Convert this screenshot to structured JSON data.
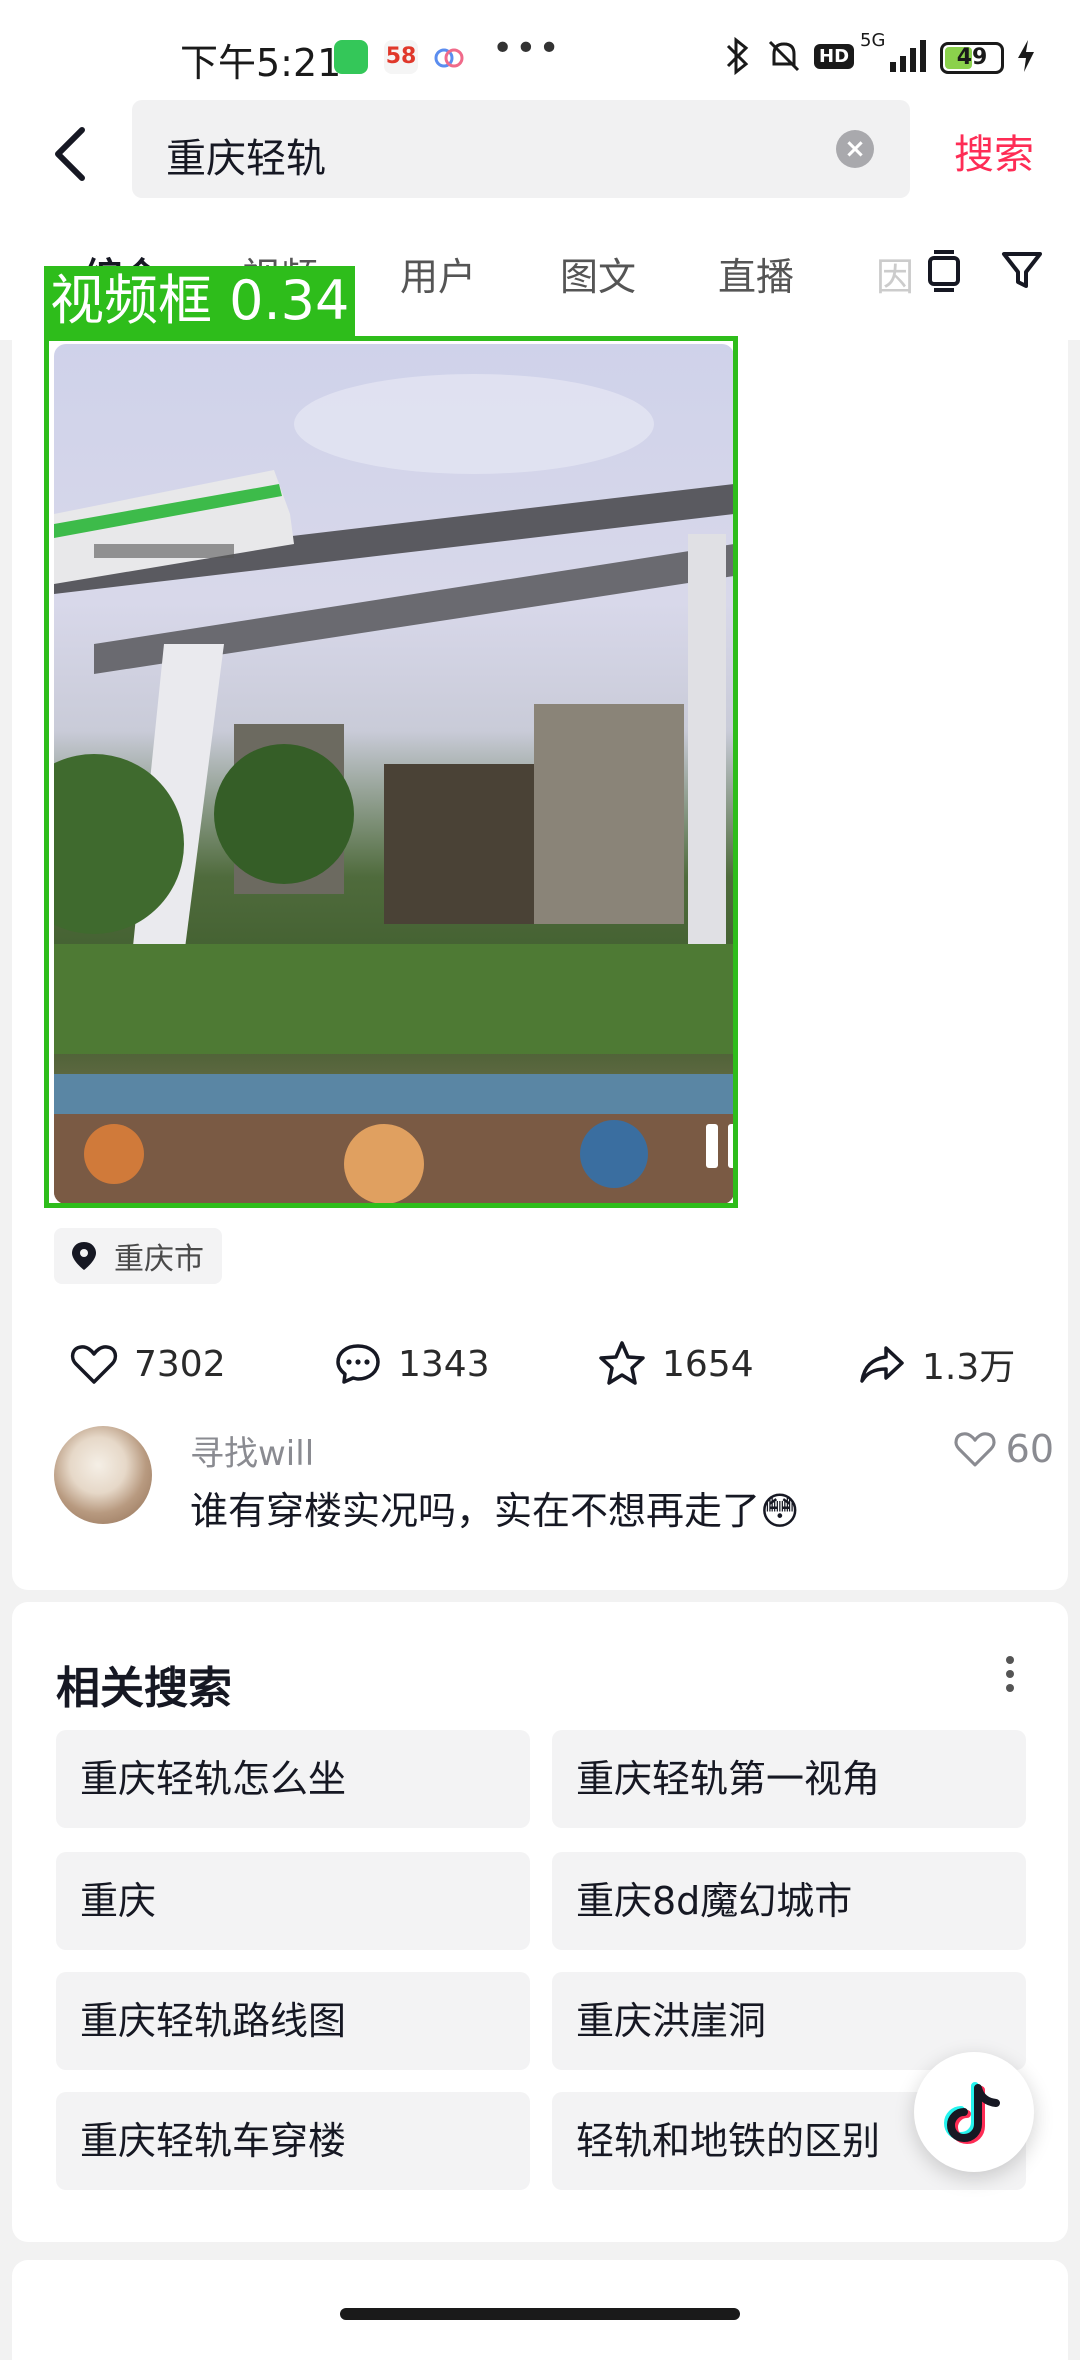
{
  "status_bar": {
    "time": "下午5:21",
    "app_58_label": "58",
    "network": "5G",
    "hd_label": "HD",
    "battery": "49"
  },
  "search": {
    "query": "重庆轻轨",
    "button": "搜索"
  },
  "tabs": [
    {
      "label": "综合",
      "active": true
    },
    {
      "label": "视频",
      "active": false
    },
    {
      "label": "用户",
      "active": false
    },
    {
      "label": "图文",
      "active": false
    },
    {
      "label": "直播",
      "active": false
    },
    {
      "label": "因",
      "active": false
    }
  ],
  "detection": {
    "label": "视频框 0.34",
    "color": "#2ebd1b"
  },
  "result": {
    "location": "重庆市",
    "likes": "7302",
    "comments": "1343",
    "favorites": "1654",
    "shares": "1.3万",
    "top_comment": {
      "user": "寻找will",
      "text": "谁有穿楼实况吗，实在不想再走了😳",
      "likes": "60"
    }
  },
  "related": {
    "title": "相关搜索",
    "items": [
      "重庆轻轨怎么坐",
      "重庆轻轨第一视角",
      "重庆",
      "重庆8d魔幻城市",
      "重庆轻轨路线图",
      "重庆洪崖洞",
      "重庆轻轨车穿楼",
      "轻轨和地铁的区别"
    ]
  },
  "colors": {
    "accent": "#fe2c55",
    "text": "#161823",
    "muted": "#8a8b91"
  }
}
